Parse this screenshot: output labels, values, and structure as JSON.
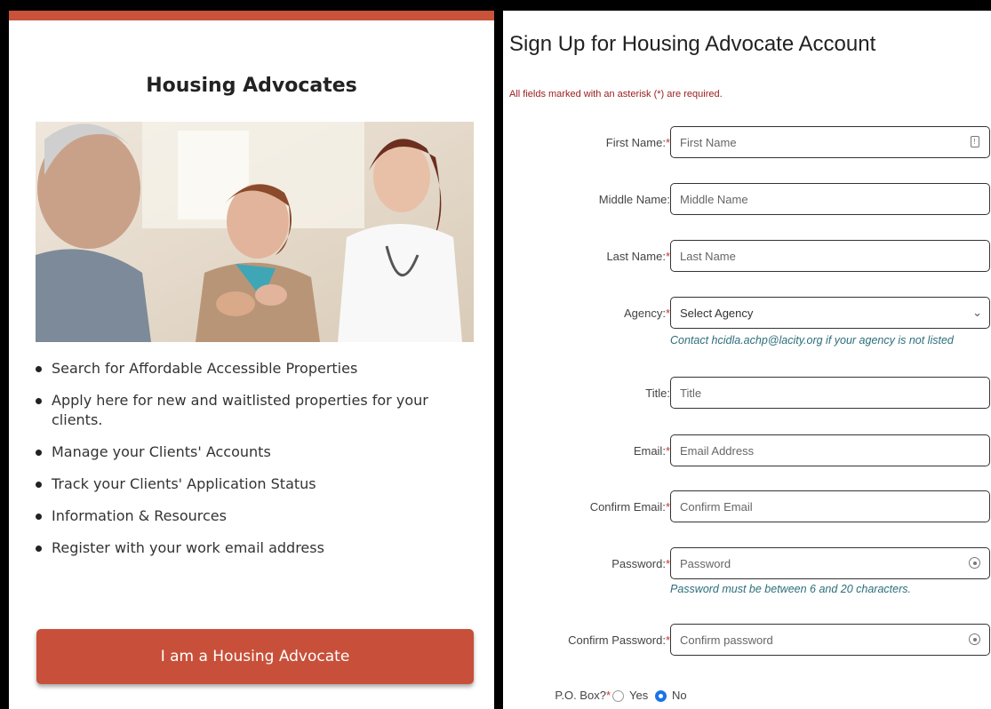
{
  "left_panel": {
    "heading": "Housing Advocates",
    "features": [
      "Search for Affordable Accessible Properties",
      "Apply here for new and waitlisted properties for your clients.",
      "Manage your Clients' Accounts",
      "Track your Clients' Application Status",
      "Information & Resources",
      "Register with your work email address"
    ],
    "cta_button": "I am a Housing Advocate",
    "accent_color": "#c8503a"
  },
  "form": {
    "title": "Sign Up for Housing Advocate Account",
    "required_note": "All fields marked with an asterisk (*) are required.",
    "first_name": {
      "label": "First Name:",
      "placeholder": "First Name",
      "required": "*"
    },
    "middle_name": {
      "label": "Middle Name:",
      "placeholder": "Middle Name"
    },
    "last_name": {
      "label": "Last Name:",
      "placeholder": "Last Name",
      "required": "*"
    },
    "agency": {
      "label": "Agency:",
      "selected": "Select Agency",
      "required": "*",
      "hint": "Contact hcidla.achp@lacity.org if your agency is not listed"
    },
    "title_field": {
      "label": "Title:",
      "placeholder": "Title"
    },
    "email": {
      "label": "Email:",
      "placeholder": "Email Address",
      "required": "*"
    },
    "confirm_email": {
      "label": "Confirm Email:",
      "placeholder": "Confirm Email",
      "required": "*"
    },
    "password": {
      "label": "Password:",
      "placeholder": "Password",
      "required": "*",
      "hint": "Password must be between 6 and 20 characters."
    },
    "confirm_password": {
      "label": "Confirm Password:",
      "placeholder": "Confirm password",
      "required": "*"
    },
    "po_box": {
      "label": "P.O. Box?",
      "required": "*",
      "options": [
        "Yes",
        "No"
      ],
      "selected": "No"
    }
  }
}
